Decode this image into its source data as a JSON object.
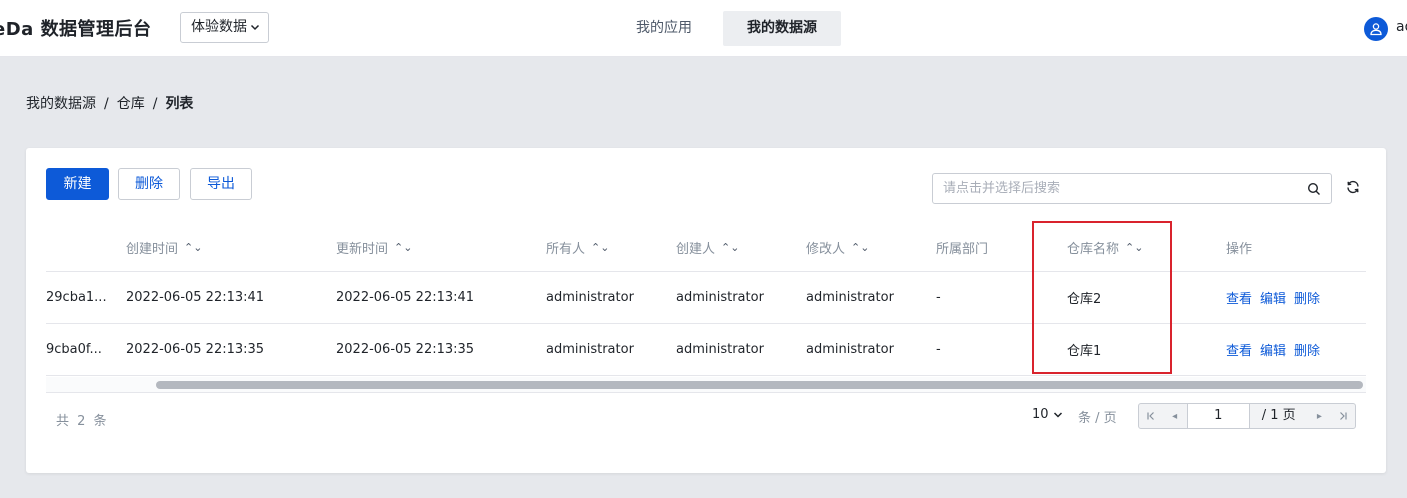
{
  "header": {
    "brand": "eDa 数据管理后台",
    "env_select": "体验数据",
    "tabs": [
      {
        "label": "我的应用",
        "active": false
      },
      {
        "label": "我的数据源",
        "active": true
      }
    ],
    "username": "ad"
  },
  "breadcrumb": [
    "我的数据源",
    "仓库",
    "列表"
  ],
  "toolbar": {
    "new_label": "新建",
    "delete_label": "删除",
    "export_label": "导出",
    "search_placeholder": "请点击并选择后搜索"
  },
  "table": {
    "columns": [
      "创建时间",
      "更新时间",
      "所有人",
      "创建人",
      "修改人",
      "所属部门",
      "仓库名称",
      "操作"
    ],
    "rows": [
      {
        "id": "29cba1...",
        "created": "2022-06-05 22:13:41",
        "updated": "2022-06-05 22:13:41",
        "owner": "administrator",
        "creator": "administrator",
        "modifier": "administrator",
        "department": "-",
        "warehouse": "仓库2",
        "actions": [
          "查看",
          "编辑",
          "删除"
        ]
      },
      {
        "id": "9cba0f...",
        "created": "2022-06-05 22:13:35",
        "updated": "2022-06-05 22:13:35",
        "owner": "administrator",
        "creator": "administrator",
        "modifier": "administrator",
        "department": "-",
        "warehouse": "仓库1",
        "actions": [
          "查看",
          "编辑",
          "删除"
        ]
      }
    ]
  },
  "footer": {
    "total": "共 2 条",
    "page_size": "10",
    "page_size_unit": "条 / 页",
    "current_page": "1",
    "total_pages": "/ 1 页"
  },
  "colors": {
    "primary": "#0d5ad8",
    "highlight": "#d9232d"
  }
}
